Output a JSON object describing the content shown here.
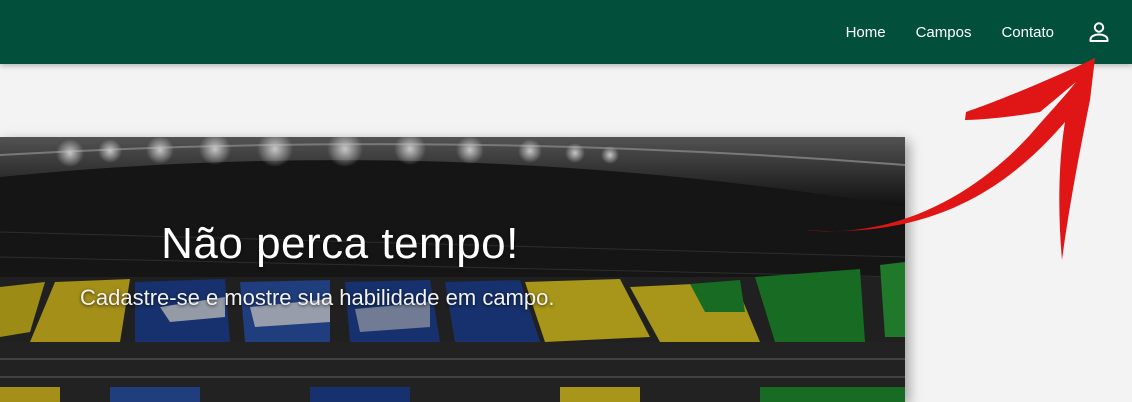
{
  "nav": {
    "items": [
      {
        "label": "Home"
      },
      {
        "label": "Campos"
      },
      {
        "label": "Contato"
      }
    ],
    "user_icon": "account-icon"
  },
  "hero": {
    "title": "Não perca tempo!",
    "subtitle": "Cadastre-se e mostre sua habilidade em campo."
  },
  "colors": {
    "navbar": "#024f3c",
    "page_bg": "#f3f3f3",
    "annotation_arrow": "#e01515"
  }
}
